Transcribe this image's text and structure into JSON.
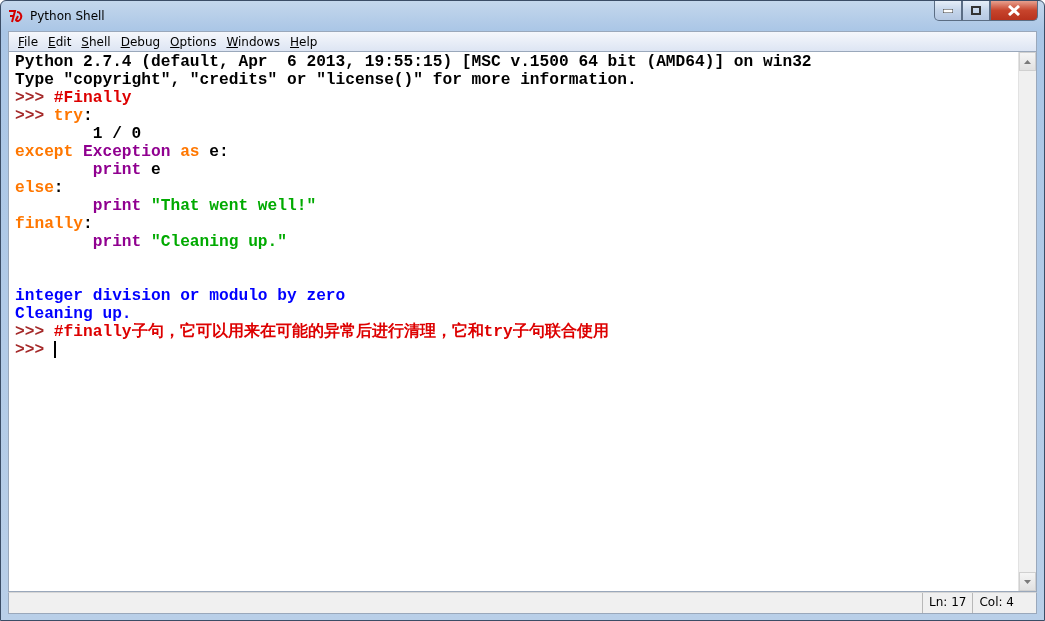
{
  "window": {
    "title": "Python Shell"
  },
  "menu": [
    {
      "label": "File"
    },
    {
      "label": "Edit"
    },
    {
      "label": "Shell"
    },
    {
      "label": "Debug"
    },
    {
      "label": "Options"
    },
    {
      "label": "Windows"
    },
    {
      "label": "Help"
    }
  ],
  "lines": [
    {
      "kind": "code",
      "indent": false,
      "tokens": [
        {
          "kind": "output",
          "text": "Python 2.7.4 (default, Apr  6 2013, 19:55:15) [MSC v.1500 64 bit (AMD64)] on win32"
        }
      ]
    },
    {
      "kind": "code",
      "indent": false,
      "tokens": [
        {
          "kind": "output",
          "text": "Type \"copyright\", \"credits\" or \"license()\" for more information."
        }
      ]
    },
    {
      "kind": "code",
      "indent": false,
      "tokens": [
        {
          "kind": "prompt",
          "text": ">>> "
        },
        {
          "kind": "comment",
          "text": "#Finally"
        }
      ]
    },
    {
      "kind": "code",
      "indent": false,
      "tokens": [
        {
          "kind": "prompt",
          "text": ">>> "
        },
        {
          "kind": "keyword",
          "text": "try"
        },
        {
          "kind": "plain",
          "text": ":"
        }
      ]
    },
    {
      "kind": "code",
      "indent": true,
      "tokens": [
        {
          "kind": "plain",
          "text": "1 / 0"
        }
      ]
    },
    {
      "kind": "code",
      "indent": false,
      "tokens": [
        {
          "kind": "keyword",
          "text": "except "
        },
        {
          "kind": "builtin",
          "text": "Exception "
        },
        {
          "kind": "keyword",
          "text": "as "
        },
        {
          "kind": "plain",
          "text": "e:"
        }
      ]
    },
    {
      "kind": "code",
      "indent": true,
      "tokens": [
        {
          "kind": "builtin",
          "text": "print "
        },
        {
          "kind": "plain",
          "text": "e"
        }
      ]
    },
    {
      "kind": "code",
      "indent": false,
      "tokens": [
        {
          "kind": "keyword",
          "text": "else"
        },
        {
          "kind": "plain",
          "text": ":"
        }
      ]
    },
    {
      "kind": "code",
      "indent": true,
      "tokens": [
        {
          "kind": "builtin",
          "text": "print "
        },
        {
          "kind": "string",
          "text": "\"That went well!\""
        }
      ]
    },
    {
      "kind": "code",
      "indent": false,
      "tokens": [
        {
          "kind": "keyword",
          "text": "finally"
        },
        {
          "kind": "plain",
          "text": ":"
        }
      ]
    },
    {
      "kind": "code",
      "indent": true,
      "tokens": [
        {
          "kind": "builtin",
          "text": "print "
        },
        {
          "kind": "string",
          "text": "\"Cleaning up.\""
        }
      ]
    },
    {
      "kind": "blank"
    },
    {
      "kind": "blank"
    },
    {
      "kind": "code",
      "indent": false,
      "tokens": [
        {
          "kind": "stdout",
          "text": "integer division or modulo by zero"
        }
      ]
    },
    {
      "kind": "code",
      "indent": false,
      "tokens": [
        {
          "kind": "stdout",
          "text": "Cleaning up."
        }
      ]
    },
    {
      "kind": "code",
      "indent": false,
      "tokens": [
        {
          "kind": "prompt",
          "text": ">>> "
        },
        {
          "kind": "comment",
          "text": "#finally子句，它可以用来在可能的异常后进行清理，它和try子句联合使用"
        }
      ]
    },
    {
      "kind": "code",
      "indent": false,
      "cursor": true,
      "tokens": [
        {
          "kind": "prompt",
          "text": ">>> "
        }
      ]
    }
  ],
  "status_bar": [
    "Ln: 17",
    "Col: 4"
  ]
}
